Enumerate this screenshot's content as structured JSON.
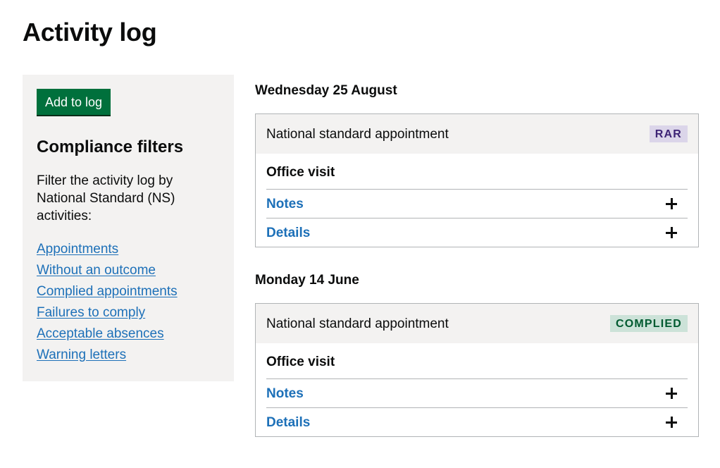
{
  "page": {
    "title": "Activity log"
  },
  "sidebar": {
    "add_button_label": "Add to log",
    "filters_heading": "Compliance filters",
    "filters_description": "Filter the activity log by National Standard (NS) activities:",
    "filters": [
      {
        "label": "Appointments"
      },
      {
        "label": "Without an outcome"
      },
      {
        "label": "Complied appointments"
      },
      {
        "label": "Failures to comply"
      },
      {
        "label": "Acceptable absences"
      },
      {
        "label": "Warning letters"
      }
    ]
  },
  "days": [
    {
      "heading": "Wednesday 25 August",
      "entries": [
        {
          "title": "National standard appointment",
          "tag": "RAR",
          "tag_color": "#dbd5e9",
          "visit_type": "Office visit",
          "notes_label": "Notes",
          "details_label": "Details"
        }
      ]
    },
    {
      "heading": "Monday 14 June",
      "entries": [
        {
          "title": "National standard appointment",
          "tag": "COMPLIED",
          "tag_color": "#cce2d8",
          "visit_type": "Office visit",
          "notes_label": "Notes",
          "details_label": "Details"
        }
      ]
    }
  ],
  "colors": {
    "link": "#1d70b8",
    "button": "#00703c",
    "panel": "#f3f2f1"
  }
}
